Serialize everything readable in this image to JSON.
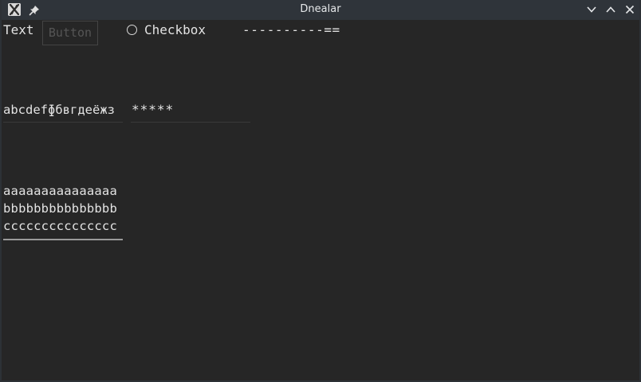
{
  "window": {
    "title": "Dnealar",
    "icons": {
      "app": "x-app-icon",
      "pin": "pin-icon",
      "minimize": "chevron-down-icon",
      "maximize": "chevron-up-icon",
      "close": "close-icon"
    }
  },
  "row1": {
    "text_label": "Text",
    "button_label": "Button",
    "checkbox_label": "Checkbox",
    "progress_text": "----------=="
  },
  "row2": {
    "text_input_value": "abcdefɸбвгдеёжз",
    "password_value": "*****"
  },
  "row3": {
    "textarea_lines": [
      "aaaaaaaaaaaaaaa",
      "bbbbbbbbbbbbbbb",
      "ccccccccccccccc"
    ]
  },
  "colors": {
    "background": "#262626",
    "titlebar": "#2f343a",
    "text": "#e3e3e3"
  }
}
